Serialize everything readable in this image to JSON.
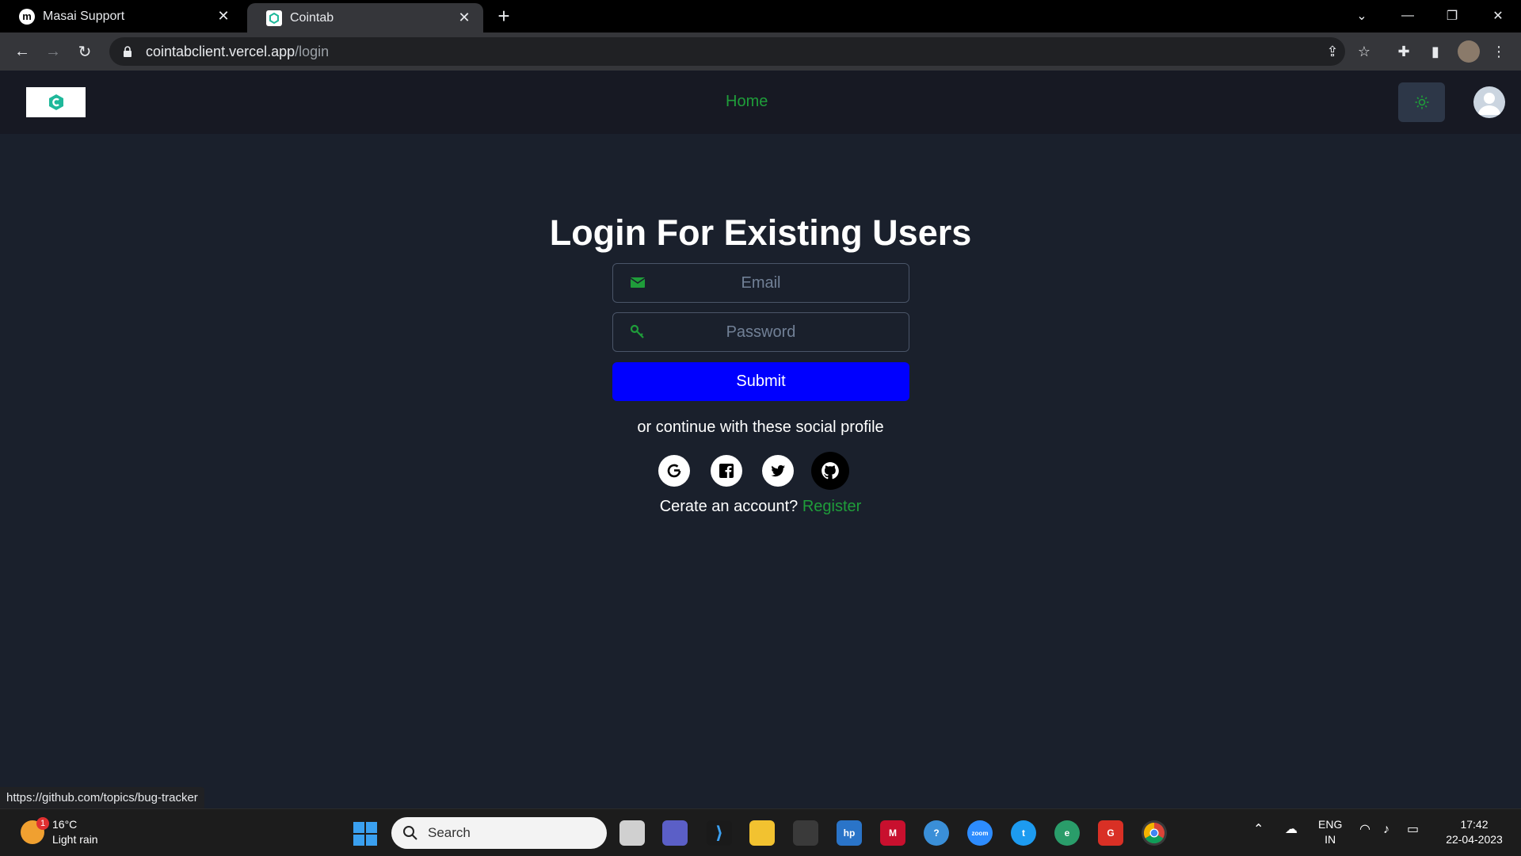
{
  "browser": {
    "tabs": [
      {
        "title": "Masai Support",
        "favicon": "m",
        "active": false
      },
      {
        "title": "Cointab",
        "favicon": "c",
        "active": true
      }
    ],
    "url_host": "cointabclient.vercel.app",
    "url_path": "/login"
  },
  "navbar": {
    "home_label": "Home"
  },
  "login": {
    "title": "Login For Existing Users",
    "email_placeholder": "Email",
    "password_placeholder": "Password",
    "submit_label": "Submit",
    "social_text": "or continue with these social profile",
    "register_prompt": "Cerate an account?",
    "register_link": "Register"
  },
  "status_bar_url": "https://github.com/topics/bug-tracker",
  "taskbar": {
    "weather_temp": "16°C",
    "weather_desc": "Light rain",
    "weather_badge": "1",
    "search_label": "Search",
    "lang_line1": "ENG",
    "lang_line2": "IN",
    "time": "17:42",
    "date": "22-04-2023"
  },
  "colors": {
    "accent_green": "#1f9d3a",
    "submit_blue": "#0000ff",
    "page_bg": "#1a202c",
    "navbar_bg": "#171923"
  }
}
